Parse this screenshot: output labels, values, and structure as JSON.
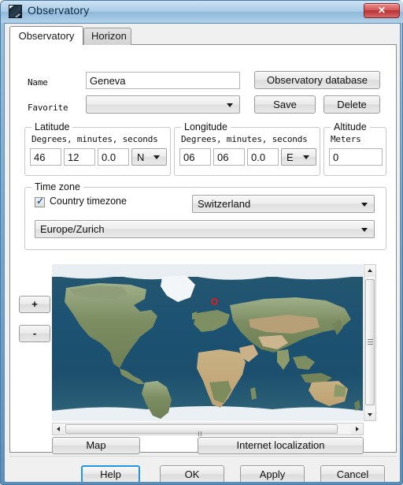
{
  "window": {
    "title": "Observatory",
    "icon": "observatory-icon",
    "close_label": "✕"
  },
  "tabs": [
    {
      "label": "Observatory",
      "active": true
    },
    {
      "label": "Horizon",
      "active": false
    }
  ],
  "form": {
    "name_label": "Name",
    "name_value": "Geneva",
    "favorite_label": "Favorite",
    "favorite_value": "",
    "observatory_database_label": "Observatory database",
    "save_label": "Save",
    "delete_label": "Delete"
  },
  "latitude": {
    "title": "Latitude",
    "hint": "Degrees, minutes, seconds",
    "degrees": "46",
    "minutes": "12",
    "seconds": "0.0",
    "hemisphere": "N"
  },
  "longitude": {
    "title": "Longitude",
    "hint": "Degrees, minutes, seconds",
    "degrees": "06",
    "minutes": "06",
    "seconds": "0.0",
    "hemisphere": "E"
  },
  "altitude": {
    "title": "Altitude",
    "hint": "Meters",
    "value": "0"
  },
  "timezone": {
    "title": "Time zone",
    "country_checkbox_label": "Country timezone",
    "country_checked": true,
    "country_value": "Switzerland",
    "zone_value": "Europe/Zurich"
  },
  "map": {
    "zoom_in_label": "+",
    "zoom_out_label": "-",
    "map_button_label": "Map",
    "internet_localization_label": "Internet localization",
    "marker_name": "geneva-marker"
  },
  "dialog_buttons": {
    "help": "Help",
    "ok": "OK",
    "apply": "Apply",
    "cancel": "Cancel"
  },
  "colors": {
    "accent": "#2196e8",
    "close_red": "#b83232",
    "marker_red": "#d81e1e",
    "frame_blue": "#5b8bb5"
  }
}
